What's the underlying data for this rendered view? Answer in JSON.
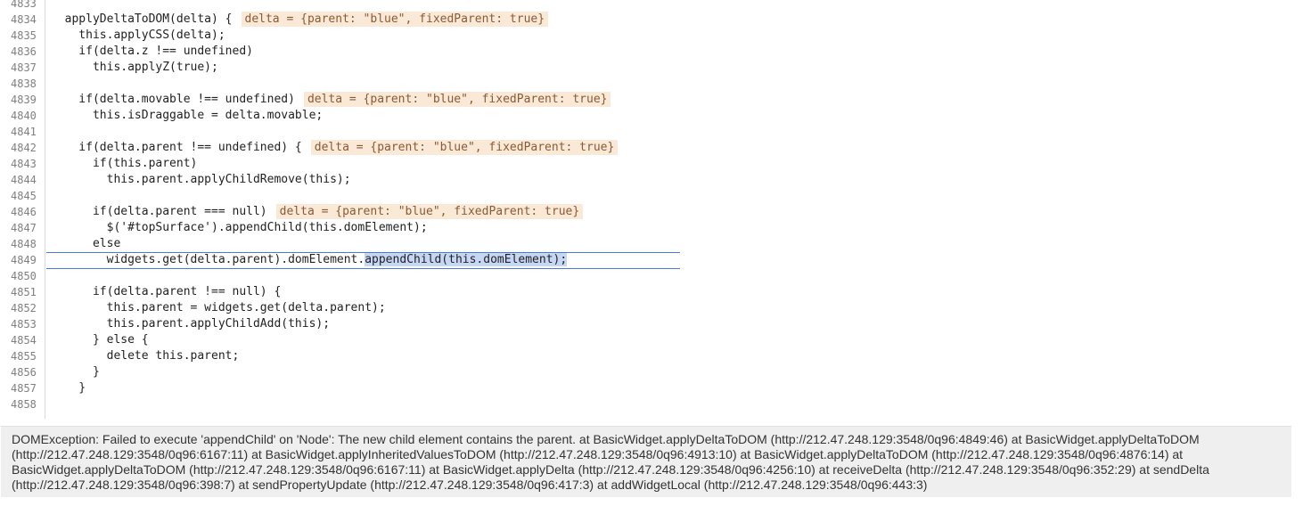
{
  "lines": [
    {
      "num": "4833",
      "code": "",
      "annotation": ""
    },
    {
      "num": "4834",
      "code": "  applyDeltaToDOM(delta) {",
      "annotation": "delta = {parent: \"blue\", fixedParent: true}"
    },
    {
      "num": "4835",
      "code": "    this.applyCSS(delta);",
      "annotation": ""
    },
    {
      "num": "4836",
      "code": "    if(delta.z !== undefined)",
      "annotation": ""
    },
    {
      "num": "4837",
      "code": "      this.applyZ(true);",
      "annotation": ""
    },
    {
      "num": "4838",
      "code": "",
      "annotation": ""
    },
    {
      "num": "4839",
      "code": "    if(delta.movable !== undefined)",
      "annotation": "delta = {parent: \"blue\", fixedParent: true}"
    },
    {
      "num": "4840",
      "code": "      this.isDraggable = delta.movable;",
      "annotation": ""
    },
    {
      "num": "4841",
      "code": "",
      "annotation": ""
    },
    {
      "num": "4842",
      "code": "    if(delta.parent !== undefined) {",
      "annotation": "delta = {parent: \"blue\", fixedParent: true}"
    },
    {
      "num": "4843",
      "code": "      if(this.parent)",
      "annotation": ""
    },
    {
      "num": "4844",
      "code": "        this.parent.applyChildRemove(this);",
      "annotation": ""
    },
    {
      "num": "4845",
      "code": "",
      "annotation": ""
    },
    {
      "num": "4846",
      "code": "      if(delta.parent === null)",
      "annotation": "delta = {parent: \"blue\", fixedParent: true}"
    },
    {
      "num": "4847",
      "code": "        $('#topSurface').appendChild(this.domElement);",
      "annotation": ""
    },
    {
      "num": "4848",
      "code": "      else",
      "annotation": ""
    },
    {
      "num": "4849",
      "code": "        widgets.get(delta.parent).domElement.",
      "selected": "appendChild(this.domElement);",
      "annotation": "",
      "current": true
    },
    {
      "num": "4850",
      "code": "",
      "annotation": ""
    },
    {
      "num": "4851",
      "code": "      if(delta.parent !== null) {",
      "annotation": ""
    },
    {
      "num": "4852",
      "code": "        this.parent = widgets.get(delta.parent);",
      "annotation": ""
    },
    {
      "num": "4853",
      "code": "        this.parent.applyChildAdd(this);",
      "annotation": ""
    },
    {
      "num": "4854",
      "code": "      } else {",
      "annotation": ""
    },
    {
      "num": "4855",
      "code": "        delete this.parent;",
      "annotation": ""
    },
    {
      "num": "4856",
      "code": "      }",
      "annotation": ""
    },
    {
      "num": "4857",
      "code": "    }",
      "annotation": ""
    },
    {
      "num": "4858",
      "code": "",
      "annotation": ""
    }
  ],
  "error": {
    "message": "DOMException: Failed to execute 'appendChild' on 'Node': The new child element contains the parent. at BasicWidget.applyDeltaToDOM (http://212.47.248.129:3548/0q96:4849:46) at BasicWidget.applyDeltaToDOM (http://212.47.248.129:3548/0q96:6167:11) at BasicWidget.applyInheritedValuesToDOM (http://212.47.248.129:3548/0q96:4913:10) at BasicWidget.applyDeltaToDOM (http://212.47.248.129:3548/0q96:4876:14) at BasicWidget.applyDeltaToDOM (http://212.47.248.129:3548/0q96:6167:11) at BasicWidget.applyDelta (http://212.47.248.129:3548/0q96:4256:10) at receiveDelta (http://212.47.248.129:3548/0q96:352:29) at sendDelta (http://212.47.248.129:3548/0q96:398:7) at sendPropertyUpdate (http://212.47.248.129:3548/0q96:417:3) at addWidgetLocal (http://212.47.248.129:3548/0q96:443:3)"
  }
}
